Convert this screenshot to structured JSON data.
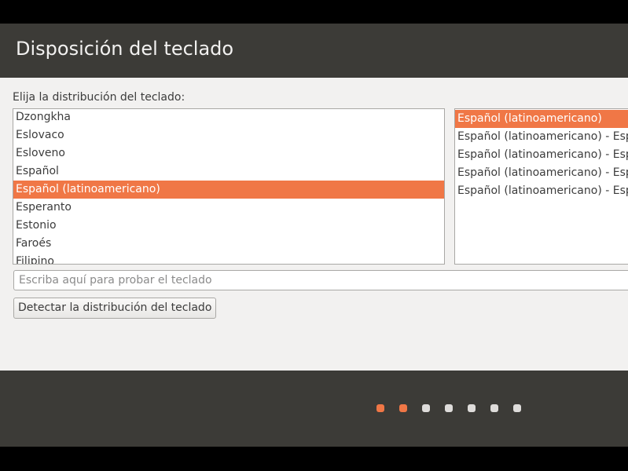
{
  "header": {
    "title": "Disposición del teclado"
  },
  "prompt": {
    "label": "Elija la distribución del teclado:"
  },
  "layouts": {
    "items": [
      {
        "label": "Dzongkha",
        "selected": false
      },
      {
        "label": "Eslovaco",
        "selected": false
      },
      {
        "label": "Esloveno",
        "selected": false
      },
      {
        "label": "Español",
        "selected": false
      },
      {
        "label": "Español (latinoamericano)",
        "selected": true
      },
      {
        "label": "Esperanto",
        "selected": false
      },
      {
        "label": "Estonio",
        "selected": false
      },
      {
        "label": "Faroés",
        "selected": false
      },
      {
        "label": "Filipino",
        "selected": false
      }
    ]
  },
  "variants": {
    "items": [
      {
        "label": "Español (latinoamericano)",
        "selected": true
      },
      {
        "label": "Español (latinoamericano) - Espa",
        "selected": false
      },
      {
        "label": "Español (latinoamericano) - Espa",
        "selected": false
      },
      {
        "label": "Español (latinoamericano) - Espa",
        "selected": false
      },
      {
        "label": "Español (latinoamericano) - Espa",
        "selected": false
      }
    ]
  },
  "test_input": {
    "value": "",
    "placeholder": "Escriba aquí para probar el teclado"
  },
  "detect_button": {
    "label": "Detectar la distribución del teclado"
  },
  "progress": {
    "total_steps": 7,
    "completed_steps": 2
  },
  "colors": {
    "accent": "#f07746",
    "header_bg": "#3c3b37",
    "content_bg": "#f2f1f0",
    "dot_inactive": "#dedcda"
  }
}
